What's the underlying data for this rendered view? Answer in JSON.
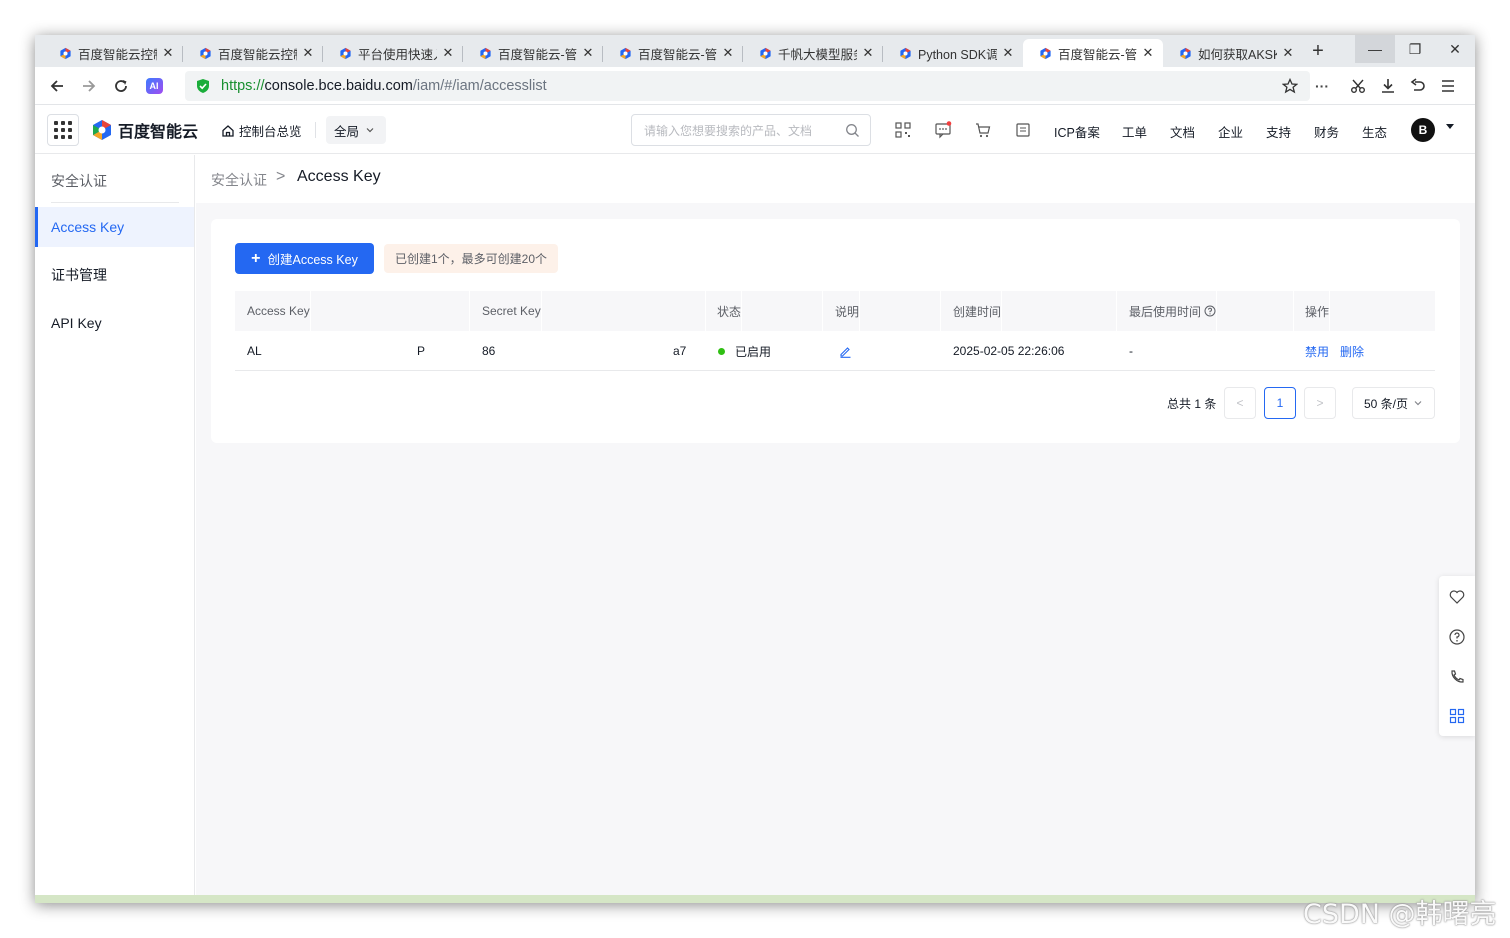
{
  "browser": {
    "tabs": [
      {
        "title": "百度智能云控制",
        "active": false
      },
      {
        "title": "百度智能云控制",
        "active": false
      },
      {
        "title": "平台使用快速入",
        "active": false
      },
      {
        "title": "百度智能云-管",
        "active": false
      },
      {
        "title": "百度智能云-管",
        "active": false
      },
      {
        "title": "千帆大模型服务",
        "active": false
      },
      {
        "title": "Python SDK调",
        "active": false
      },
      {
        "title": "百度智能云-管",
        "active": true
      },
      {
        "title": "如何获取AKSK",
        "active": false
      }
    ],
    "tab_close_glyph": "✕",
    "new_tab_glyph": "+",
    "window_buttons": {
      "minimize": "—",
      "maximize": "❐",
      "close": "✕"
    },
    "url": {
      "scheme": "https://",
      "host": "console.bce.baidu.com",
      "path": "/iam/#/iam/accesslist"
    },
    "ai_badge": "AI"
  },
  "header": {
    "logo_text": "百度智能云",
    "console_home": "控制台总览",
    "region": "全局",
    "search_placeholder": "请输入您想要搜索的产品、文档",
    "links": [
      "ICP备案",
      "工单",
      "文档",
      "企业",
      "支持",
      "财务",
      "生态"
    ],
    "avatar_letter": "B"
  },
  "sidebar": {
    "title": "安全认证",
    "items": [
      {
        "label": "Access Key",
        "active": true
      },
      {
        "label": "证书管理",
        "active": false
      },
      {
        "label": "API Key",
        "active": false
      }
    ]
  },
  "breadcrumb": {
    "parent": "安全认证",
    "separator": ">",
    "current": "Access Key"
  },
  "toolbar": {
    "create_button": "创建Access Key",
    "create_icon": "+",
    "quota_text": "已创建1个，最多可创建20个"
  },
  "table": {
    "columns": [
      "Access Key",
      "Secret Key",
      "状态",
      "说明",
      "创建时间",
      "最后使用时间",
      "操作"
    ],
    "rows": [
      {
        "access_key_start": "AL",
        "access_key_end": "P",
        "secret_key_start": "86",
        "secret_key_end": "a7",
        "status": "已启用",
        "created_at": "2025-02-05 22:26:06",
        "last_used": "-",
        "actions": [
          "禁用",
          "删除"
        ]
      }
    ]
  },
  "pagination": {
    "total": "总共 1 条",
    "current_page": "1",
    "prev_glyph": "<",
    "next_glyph": ">",
    "page_size": "50 条/页"
  },
  "float_toolbar": [
    "heart-icon",
    "help-icon",
    "phone-icon",
    "apps-icon"
  ],
  "watermark": "CSDN @韩曙亮",
  "colors": {
    "primary": "#2468f2",
    "status_enabled": "#30bf13",
    "sidebar_active_bg": "#eef3fe",
    "quota_bg": "#fdf1e9"
  }
}
